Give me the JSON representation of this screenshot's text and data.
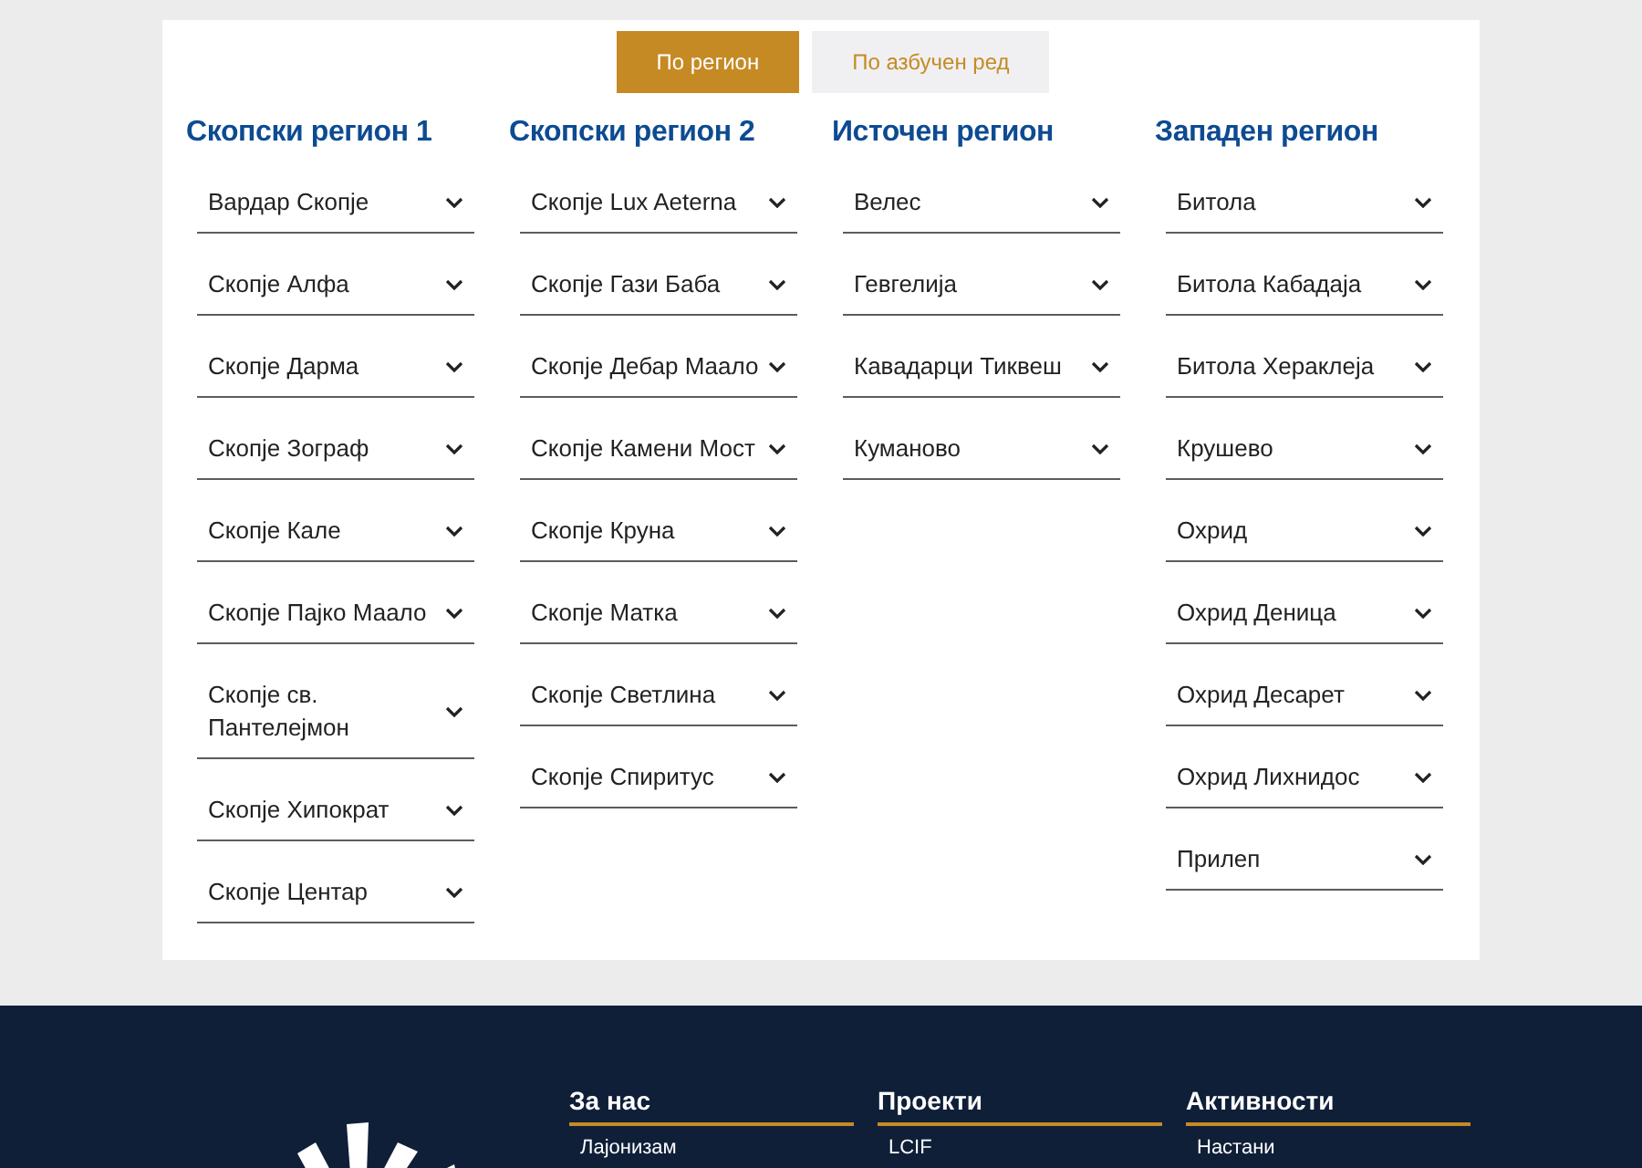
{
  "view_toggle": [
    {
      "label": "По регион",
      "selected": true
    },
    {
      "label": "По азбучен ред",
      "selected": false
    }
  ],
  "regions": [
    {
      "title": "Скопски регион 1",
      "clubs": [
        {
          "name": "Вардар Скопје",
          "expanded": false
        },
        {
          "name": "Скопје Алфа",
          "expanded": false
        },
        {
          "name": "Скопје Дарма",
          "expanded": false
        },
        {
          "name": "Скопје Зограф",
          "expanded": false
        },
        {
          "name": "Скопје Кале",
          "expanded": false
        },
        {
          "name": "Скопје Пајко Маало",
          "expanded": false
        },
        {
          "name": "Скопје св. Пантелејмон",
          "expanded": false
        },
        {
          "name": "Скопје Хипократ",
          "expanded": false
        },
        {
          "name": "Скопје Центар",
          "expanded": false
        }
      ]
    },
    {
      "title": "Скопски регион 2",
      "clubs": [
        {
          "name": "Скопје Lux Aeterna",
          "expanded": false
        },
        {
          "name": "Скопје Гази Баба",
          "expanded": false
        },
        {
          "name": "Скопје Дебар Маало",
          "expanded": false
        },
        {
          "name": "Скопје Камени Мост",
          "expanded": false
        },
        {
          "name": "Скопје Круна",
          "expanded": false
        },
        {
          "name": "Скопје Матка",
          "expanded": false
        },
        {
          "name": "Скопје Светлина",
          "expanded": false
        },
        {
          "name": "Скопје Спиритус",
          "expanded": false
        }
      ]
    },
    {
      "title": "Источен регион",
      "clubs": [
        {
          "name": "Велес",
          "expanded": false
        },
        {
          "name": "Гевгелија",
          "expanded": false
        },
        {
          "name": "Кавадарци Тиквеш",
          "expanded": false
        },
        {
          "name": "Куманово",
          "expanded": false
        }
      ]
    },
    {
      "title": "Западен регион",
      "clubs": [
        {
          "name": "Битола",
          "expanded": false
        },
        {
          "name": "Битола Кабадаја",
          "expanded": false
        },
        {
          "name": "Битола Хераклеја",
          "expanded": false
        },
        {
          "name": "Крушево",
          "expanded": false
        },
        {
          "name": "Охрид",
          "expanded": false
        },
        {
          "name": "Охрид Деница",
          "expanded": false
        },
        {
          "name": "Охрид Десарет",
          "expanded": false
        },
        {
          "name": "Охрид Лихнидос",
          "expanded": false
        },
        {
          "name": "Прилеп",
          "expanded": false
        }
      ]
    }
  ],
  "footer": {
    "columns": [
      {
        "title": "За нас",
        "links": [
          "Лајонизам"
        ]
      },
      {
        "title": "Проекти",
        "links": [
          "LCIF"
        ]
      },
      {
        "title": "Активности",
        "links": [
          "Настани"
        ]
      }
    ]
  }
}
